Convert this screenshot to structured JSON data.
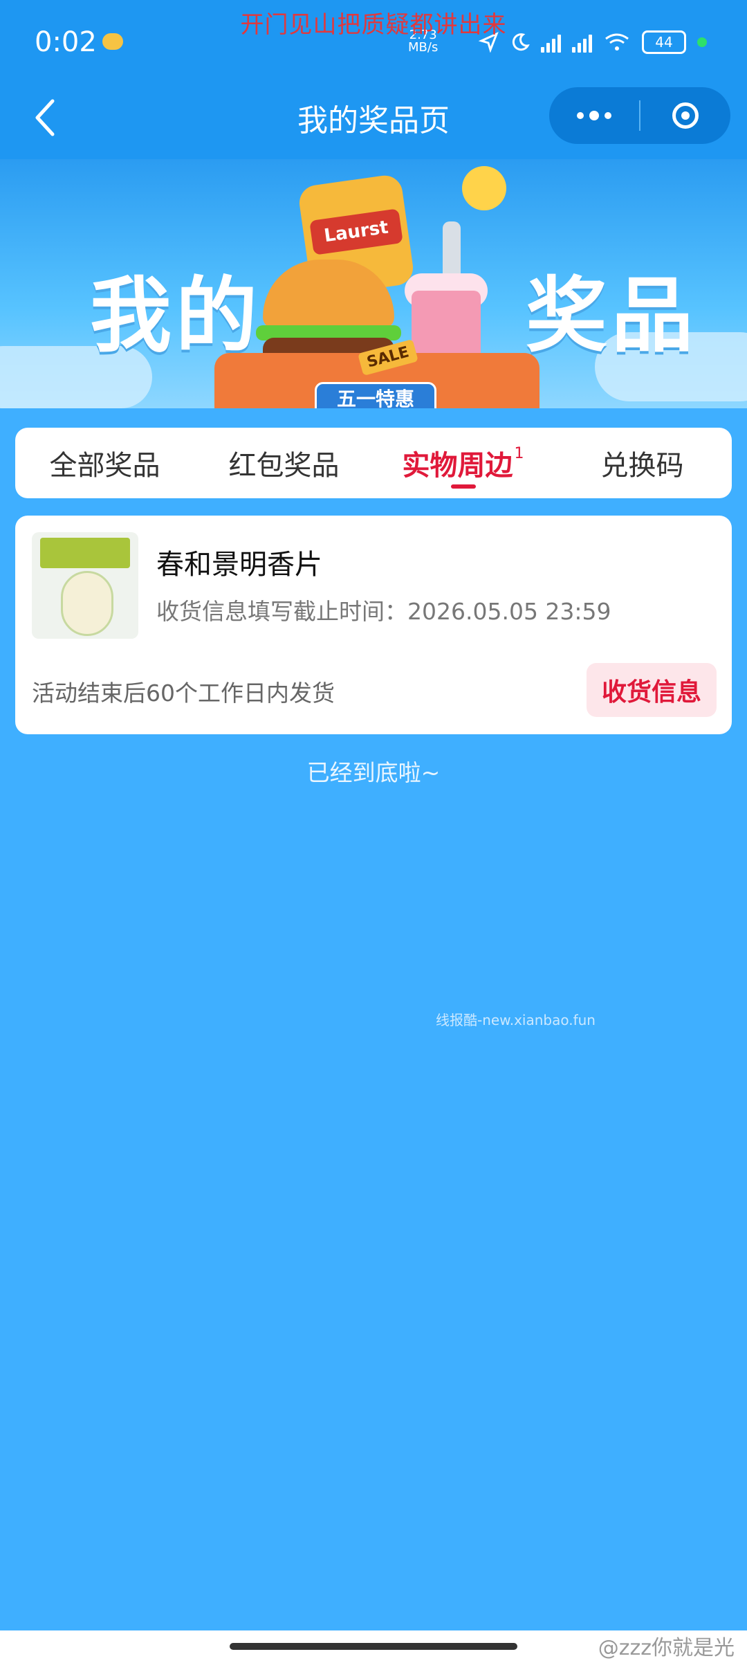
{
  "overlay_text": "开门见山把质疑都讲出来",
  "status_bar": {
    "time": "0:02",
    "net_rate": "2.73",
    "net_unit": "MB/s",
    "battery": "44"
  },
  "nav": {
    "title": "我的奖品页"
  },
  "banner": {
    "left_text": "我的",
    "right_text": "奖品",
    "chips_brand": "Laurst",
    "sale_label": "SALE",
    "promo_label": "五一特惠"
  },
  "tabs": [
    {
      "label": "全部奖品",
      "active": false
    },
    {
      "label": "红包奖品",
      "active": false
    },
    {
      "label": "实物周边",
      "active": true,
      "badge": "1"
    },
    {
      "label": "兑换码",
      "active": false
    }
  ],
  "prize": {
    "title": "春和景明香片",
    "deadline_label": "收货信息填写截止时间：",
    "deadline_value": "2026.05.05 23:59",
    "ship_note": "活动结束后60个工作日内发货",
    "action_label": "收货信息"
  },
  "list_end": "已经到底啦~",
  "watermark": "线报酷-new.xianbao.fun",
  "footer_credit": "@zzz你就是光",
  "colors": {
    "page_bg": "#3FAFFF",
    "nav_bg": "#1E97F2",
    "accent": "#E0193A"
  }
}
